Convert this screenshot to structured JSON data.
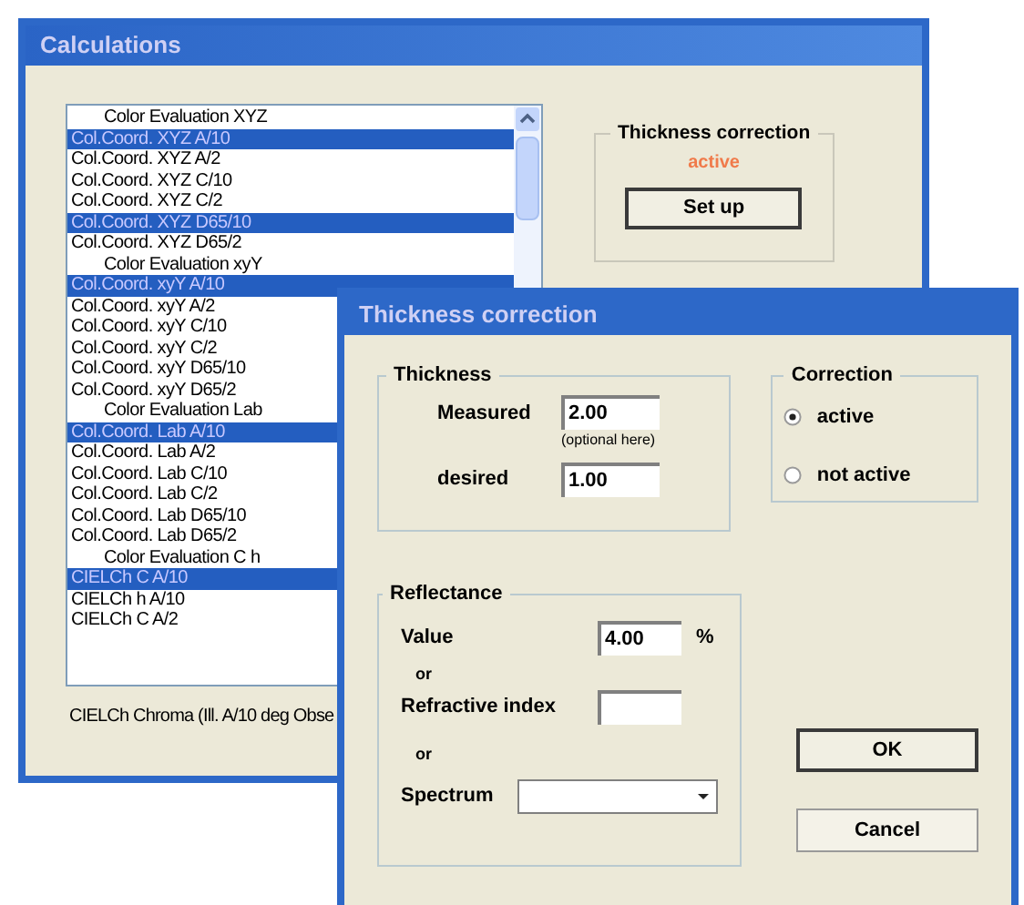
{
  "main_window": {
    "title": "Calculations",
    "list": [
      {
        "kind": "heading",
        "label": "Color Evaluation XYZ",
        "selected": false
      },
      {
        "kind": "item",
        "label": "Col.Coord. XYZ A/10",
        "selected": true
      },
      {
        "kind": "item",
        "label": "Col.Coord. XYZ A/2",
        "selected": false
      },
      {
        "kind": "item",
        "label": "Col.Coord. XYZ C/10",
        "selected": false
      },
      {
        "kind": "item",
        "label": "Col.Coord. XYZ C/2",
        "selected": false
      },
      {
        "kind": "item",
        "label": "Col.Coord. XYZ D65/10",
        "selected": true
      },
      {
        "kind": "item",
        "label": "Col.Coord. XYZ D65/2",
        "selected": false
      },
      {
        "kind": "heading",
        "label": "Color Evaluation xyY",
        "selected": false
      },
      {
        "kind": "item",
        "label": "Col.Coord. xyY A/10",
        "selected": true
      },
      {
        "kind": "item",
        "label": "Col.Coord. xyY A/2",
        "selected": false
      },
      {
        "kind": "item",
        "label": "Col.Coord. xyY C/10",
        "selected": false
      },
      {
        "kind": "item",
        "label": "Col.Coord. xyY C/2",
        "selected": false
      },
      {
        "kind": "item",
        "label": "Col.Coord. xyY D65/10",
        "selected": false
      },
      {
        "kind": "item",
        "label": "Col.Coord. xyY D65/2",
        "selected": false
      },
      {
        "kind": "heading",
        "label": "Color Evaluation Lab",
        "selected": false
      },
      {
        "kind": "item",
        "label": "Col.Coord. Lab A/10",
        "selected": true
      },
      {
        "kind": "item",
        "label": "Col.Coord. Lab A/2",
        "selected": false
      },
      {
        "kind": "item",
        "label": "Col.Coord. Lab C/10",
        "selected": false
      },
      {
        "kind": "item",
        "label": "Col.Coord. Lab C/2",
        "selected": false
      },
      {
        "kind": "item",
        "label": "Col.Coord. Lab D65/10",
        "selected": false
      },
      {
        "kind": "item",
        "label": "Col.Coord. Lab D65/2",
        "selected": false
      },
      {
        "kind": "heading",
        "label": "Color Evaluation C h",
        "selected": false
      },
      {
        "kind": "item",
        "label": "CIELCh C A/10",
        "selected": true
      },
      {
        "kind": "item",
        "label": "CIELCh h A/10",
        "selected": false
      },
      {
        "kind": "item",
        "label": "CIELCh C A/2",
        "selected": false
      }
    ],
    "description": "CIELCh Chroma (Ill. A/10 deg Obse",
    "thickness_group": {
      "title": "Thickness correction",
      "status": "active",
      "button": "Set up"
    }
  },
  "dialog": {
    "title": "Thickness correction",
    "thickness": {
      "title": "Thickness",
      "measured_label": "Measured",
      "measured_value": "2.00",
      "measured_hint": "(optional here)",
      "desired_label": "desired",
      "desired_value": "1.00"
    },
    "correction": {
      "title": "Correction",
      "options": [
        {
          "label": "active",
          "selected": true
        },
        {
          "label": "not active",
          "selected": false
        }
      ]
    },
    "reflectance": {
      "title": "Reflectance",
      "value_label": "Value",
      "value": "4.00",
      "unit": "%",
      "or_1": "or",
      "refractive_label": "Refractive index",
      "or_2": "or",
      "spectrum_label": "Spectrum"
    },
    "buttons": [
      "OK",
      "Cancel"
    ]
  }
}
